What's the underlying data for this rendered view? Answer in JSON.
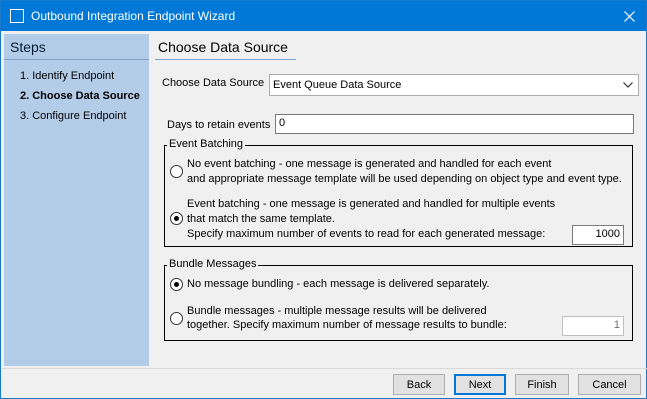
{
  "window": {
    "title": "Outbound Integration Endpoint Wizard"
  },
  "steps": {
    "title": "Steps",
    "items": [
      {
        "label": "1. Identify Endpoint",
        "active": false
      },
      {
        "label": "2. Choose Data Source",
        "active": true
      },
      {
        "label": "3. Configure Endpoint",
        "active": false
      }
    ]
  },
  "page": {
    "heading": "Choose Data Source",
    "data_source": {
      "label": "Choose Data Source",
      "selected": "Event Queue Data Source"
    },
    "retain": {
      "label": "Days to retain events",
      "value": "0"
    },
    "event_batching": {
      "legend": "Event Batching",
      "option1_line1": "No event batching - one message is generated and handled for each event",
      "option1_line2": "and appropriate message template will be used depending on object type and event type.",
      "option1_selected": false,
      "option2_line1": "Event batching - one message is generated and handled for multiple events",
      "option2_line2": "that match the same template.",
      "option2_line3": "Specify maximum number of events to read for each generated message:",
      "option2_selected": true,
      "max_events": "1000"
    },
    "bundle_messages": {
      "legend": "Bundle Messages",
      "option1_label": "No message bundling - each message is delivered separately.",
      "option1_selected": true,
      "option2_line1": "Bundle messages - multiple message results will be delivered",
      "option2_line2": "together. Specify maximum number of message results to bundle:",
      "option2_selected": false,
      "max_results": "1"
    }
  },
  "buttons": {
    "back": "Back",
    "next": "Next",
    "finish": "Finish",
    "cancel": "Cancel"
  },
  "colors": {
    "titlebar": "#0078d7",
    "steps_panel": "#b3cce8"
  }
}
